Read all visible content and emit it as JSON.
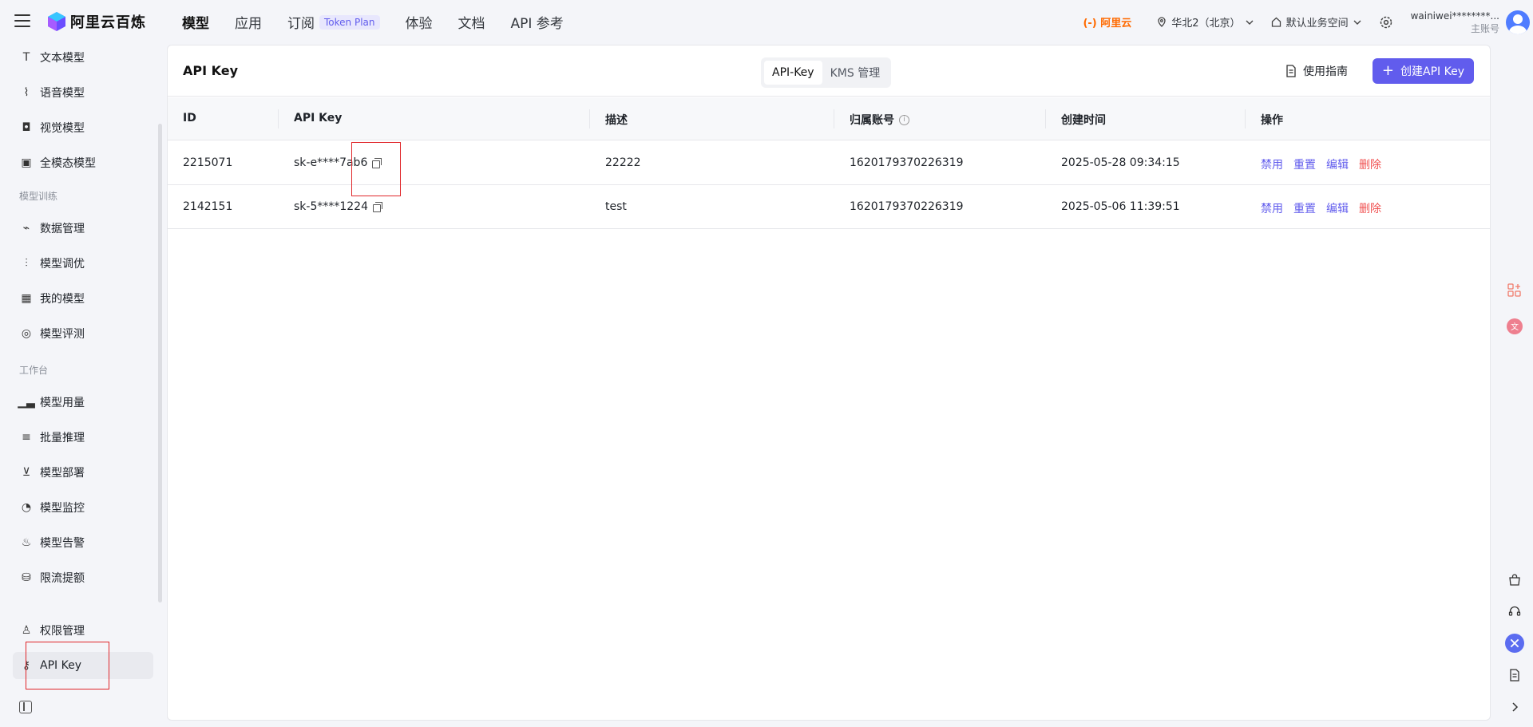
{
  "header": {
    "brand": "阿里云百炼",
    "nav": [
      {
        "label": "模型",
        "active": true
      },
      {
        "label": "应用"
      },
      {
        "label": "订阅",
        "badge": "Token Plan"
      },
      {
        "label": "体验"
      },
      {
        "label": "文档"
      },
      {
        "label": "API 参考"
      }
    ],
    "aliyun_logo": "(-) 阿里云",
    "region": "华北2（北京）",
    "workspace": "默认业务空间",
    "account_name": "wainiwei********...",
    "account_role": "主账号"
  },
  "sidebar": {
    "items_top": [
      {
        "label": "文本模型",
        "icon": "text-icon"
      },
      {
        "label": "语音模型",
        "icon": "waveform-icon"
      },
      {
        "label": "视觉模型",
        "icon": "camera-icon"
      },
      {
        "label": "全模态模型",
        "icon": "omni-icon"
      }
    ],
    "section_training": "模型训练",
    "items_training": [
      {
        "label": "数据管理",
        "icon": "chart-line-icon"
      },
      {
        "label": "模型调优",
        "icon": "sliders-icon"
      },
      {
        "label": "我的模型",
        "icon": "grid-icon"
      },
      {
        "label": "模型评测",
        "icon": "compass-icon"
      }
    ],
    "section_workbench": "工作台",
    "items_workbench": [
      {
        "label": "模型用量",
        "icon": "bar-chart-icon"
      },
      {
        "label": "批量推理",
        "icon": "list-icon"
      },
      {
        "label": "模型部署",
        "icon": "deploy-icon"
      },
      {
        "label": "模型监控",
        "icon": "pie-icon"
      },
      {
        "label": "模型告警",
        "icon": "alarm-icon"
      },
      {
        "label": "限流提额",
        "icon": "database-icon"
      }
    ],
    "items_bottom": [
      {
        "label": "权限管理",
        "icon": "user-icon"
      },
      {
        "label": "API Key",
        "icon": "key-icon",
        "active": true
      }
    ]
  },
  "page": {
    "title": "API Key",
    "tabs": [
      "API-Key",
      "KMS 管理"
    ],
    "active_tab": "API-Key",
    "guide_label": "使用指南",
    "create_label": "创建API Key"
  },
  "table": {
    "columns": [
      "ID",
      "API Key",
      "描述",
      "归属账号",
      "创建时间",
      "操作"
    ],
    "rows": [
      {
        "id": "2215071",
        "key": "sk-e****7ab6",
        "desc": "22222",
        "account": "1620179370226319",
        "created": "2025-05-28 09:34:15"
      },
      {
        "id": "2142151",
        "key": "sk-5****1224",
        "desc": "test",
        "account": "1620179370226319",
        "created": "2025-05-06 11:39:51"
      }
    ],
    "actions": [
      "禁用",
      "重置",
      "编辑",
      "删除"
    ]
  },
  "colors": {
    "accent": "#615ced",
    "danger": "#f05050",
    "brand_orange": "#ff6a00",
    "annotation": "#e0262a"
  }
}
